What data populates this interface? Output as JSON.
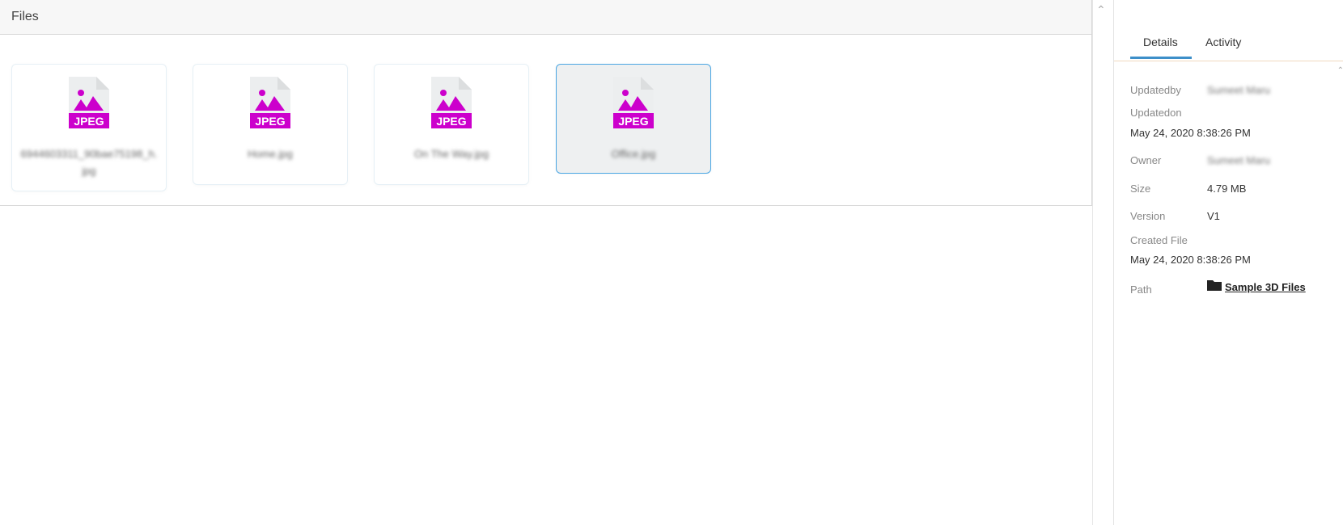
{
  "files_panel": {
    "title": "Files",
    "items": [
      {
        "name": "6944603311_90bae75198_h.jpg",
        "type_label": "JPEG",
        "selected": false
      },
      {
        "name": "Home.jpg",
        "type_label": "JPEG",
        "selected": false
      },
      {
        "name": "On The Way.jpg",
        "type_label": "JPEG",
        "selected": false
      },
      {
        "name": "Office.jpg",
        "type_label": "JPEG",
        "selected": true
      }
    ]
  },
  "details_panel": {
    "tabs": [
      {
        "label": "Details",
        "active": true
      },
      {
        "label": "Activity",
        "active": false
      }
    ],
    "fields": {
      "updatedby": {
        "label": "Updatedby",
        "value": "Sumeet Maru"
      },
      "updatedon": {
        "label": "Updatedon",
        "value": "May 24, 2020 8:38:26 PM"
      },
      "owner": {
        "label": "Owner",
        "value": "Sumeet Maru"
      },
      "size": {
        "label": "Size",
        "value": "4.79 MB"
      },
      "version": {
        "label": "Version",
        "value": "V1"
      },
      "created_file": {
        "label": "Created File",
        "value": "May 24, 2020 8:38:26 PM"
      },
      "path": {
        "label": "Path",
        "value": "Sample 3D Files",
        "icon": "folder-icon"
      }
    }
  },
  "colors": {
    "jpeg_icon": "#cc00cc",
    "tab_accent": "#3d8fc9",
    "selected_border": "#4aa6e3"
  }
}
